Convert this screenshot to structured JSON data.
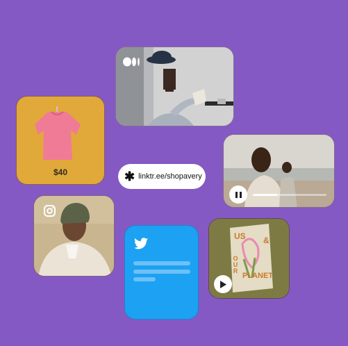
{
  "link": {
    "url": "linktr.ee/shopavery",
    "icon": "linktree-asterisk-icon"
  },
  "product": {
    "price": "$40",
    "image": "pink-tshirt-image"
  },
  "medium": {
    "icon": "medium-logo-icon",
    "image": "man-in-bucket-hat-photo"
  },
  "video": {
    "icon": "pause-icon",
    "progress": 0.33,
    "image": "men-on-beach-photo"
  },
  "instagram": {
    "icon": "instagram-icon",
    "image": "man-in-beanie-photo"
  },
  "twitter": {
    "icon": "twitter-bird-icon"
  },
  "book": {
    "icon": "play-icon",
    "cover_words": [
      "US",
      "&",
      "OUR",
      "PLANET"
    ]
  },
  "colors": {
    "background": "#8459c3",
    "product_card": "#e1a93a",
    "twitter_card": "#1da1f2",
    "book_card": "#7e7a44"
  }
}
